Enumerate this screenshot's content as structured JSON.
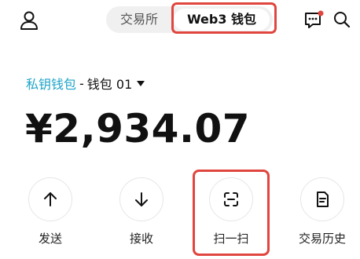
{
  "header": {
    "tabs": [
      {
        "label": "交易所",
        "active": false
      },
      {
        "label": "Web3 钱包",
        "active": true
      }
    ],
    "icons": [
      "user-icon",
      "chat-icon",
      "search-icon"
    ],
    "notification_dot_color": "#e0453e"
  },
  "wallet": {
    "type_label": "私钥钱包",
    "separator": "-",
    "name": "钱包 01",
    "balance": "¥2,934.07",
    "accent_color": "#1ea4c8"
  },
  "actions": [
    {
      "label": "发送",
      "icon": "arrow-up-icon"
    },
    {
      "label": "接收",
      "icon": "arrow-down-icon"
    },
    {
      "label": "扫一扫",
      "icon": "scan-icon"
    },
    {
      "label": "交易历史",
      "icon": "document-icon"
    }
  ],
  "highlight_color": "#e0453e"
}
